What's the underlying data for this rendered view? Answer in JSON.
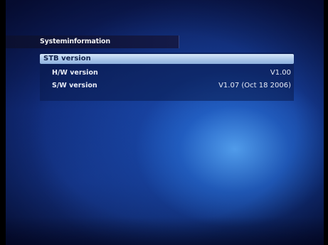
{
  "window": {
    "title": "Systeminformation"
  },
  "menu": {
    "selected_item": "STB version"
  },
  "info_rows": [
    {
      "label": "H/W version",
      "value": "V1.00"
    },
    {
      "label": "S/W version",
      "value": "V1.07 (Oct 18 2006)"
    }
  ],
  "colors": {
    "highlight": "#a9c6ea",
    "background": "#102a78",
    "text": "#e8ecf6"
  }
}
